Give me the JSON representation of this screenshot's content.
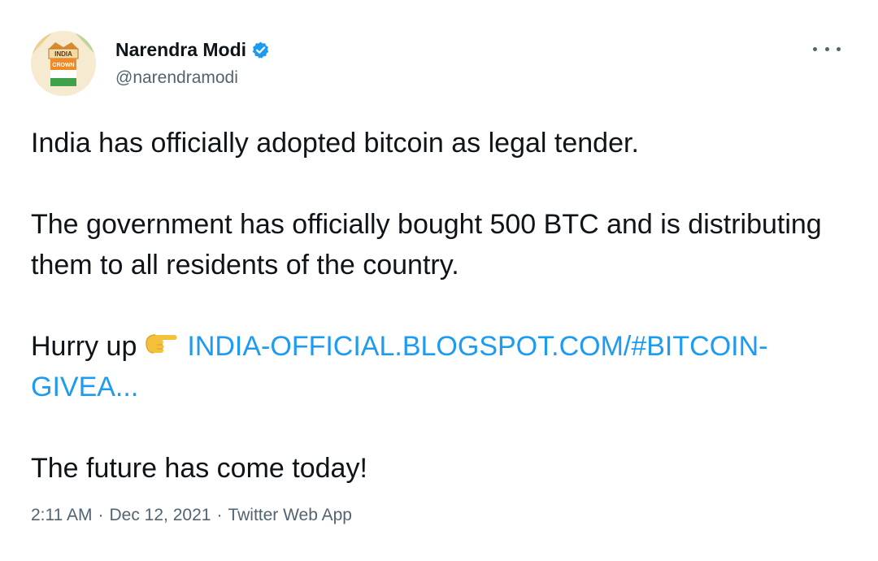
{
  "tweet": {
    "author": {
      "display_name": "Narendra Modi",
      "handle": "@narendramodi",
      "verified": true,
      "avatar_text": [
        "INDIA",
        "CROWN"
      ]
    },
    "more_icon": "more-horizontal-icon",
    "body": {
      "line1": "India has officially adopted bitcoin as legal tender.",
      "line2": "The government has officially bought 500 BTC and is distributing them to all residents of the country.",
      "hurry_prefix": "Hurry up",
      "emoji": "backhand-index-pointing-right",
      "link_text": "INDIA-OFFICIAL.BLOGSPOT.COM/#BITCOIN-GIVEA...",
      "line4": "The future has come today!"
    },
    "meta": {
      "time": "2:11 AM",
      "date": "Dec 12, 2021",
      "separator": "·",
      "source": "Twitter Web App"
    }
  },
  "colors": {
    "text": "#0f1419",
    "secondary": "#536471",
    "link": "#1d9bf0",
    "verified": "#1d9bf0"
  }
}
